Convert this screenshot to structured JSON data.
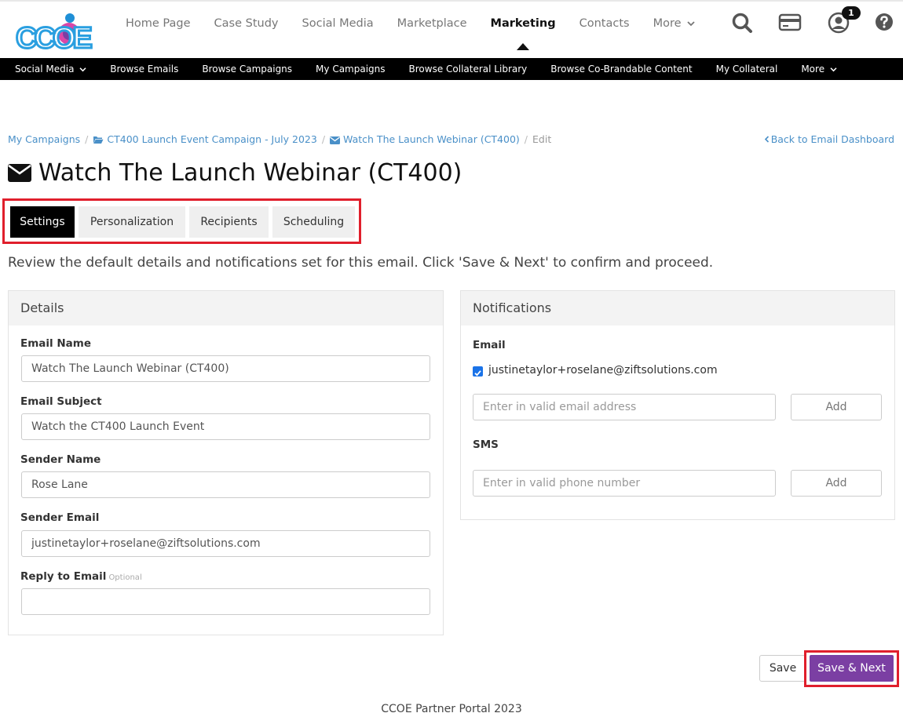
{
  "topnav": {
    "items": [
      {
        "label": "Home Page"
      },
      {
        "label": "Case Study"
      },
      {
        "label": "Social Media"
      },
      {
        "label": "Marketplace"
      },
      {
        "label": "Marketing"
      },
      {
        "label": "Contacts"
      },
      {
        "label": "More"
      }
    ],
    "notification_count": "1"
  },
  "subnav": {
    "items": [
      {
        "label": "Social Media"
      },
      {
        "label": "Browse Emails"
      },
      {
        "label": "Browse Campaigns"
      },
      {
        "label": "My Campaigns"
      },
      {
        "label": "Browse Collateral Library"
      },
      {
        "label": "Browse Co-Brandable Content"
      },
      {
        "label": "My Collateral"
      },
      {
        "label": "More"
      }
    ]
  },
  "breadcrumb": {
    "items": [
      {
        "label": "My Campaigns"
      },
      {
        "label": "CT400 Launch Event Campaign - July 2023"
      },
      {
        "label": "Watch The Launch Webinar (CT400)"
      },
      {
        "label": "Edit"
      }
    ],
    "back_label": "Back to Email Dashboard"
  },
  "page": {
    "title": "Watch The Launch Webinar (CT400)",
    "intro": "Review the default details and notifications set for this email. Click 'Save & Next' to confirm and proceed."
  },
  "tabs": [
    {
      "label": "Settings"
    },
    {
      "label": "Personalization"
    },
    {
      "label": "Recipients"
    },
    {
      "label": "Scheduling"
    }
  ],
  "details": {
    "heading": "Details",
    "email_name_label": "Email Name",
    "email_name_value": "Watch The Launch Webinar (CT400)",
    "email_subject_label": "Email Subject",
    "email_subject_value": "Watch the CT400 Launch Event",
    "sender_name_label": "Sender Name",
    "sender_name_value": "Rose Lane",
    "sender_email_label": "Sender Email",
    "sender_email_value": "justinetaylor+roselane@ziftsolutions.com",
    "reply_label": "Reply to Email",
    "reply_optional": "Optional",
    "reply_value": ""
  },
  "notifications": {
    "heading": "Notifications",
    "email_label": "Email",
    "checked_email": "justinetaylor+roselane@ziftsolutions.com",
    "email_placeholder": "Enter in valid email address",
    "add_label": "Add",
    "sms_label": "SMS",
    "sms_placeholder": "Enter in valid phone number"
  },
  "actions": {
    "save_label": "Save",
    "save_next_label": "Save & Next"
  },
  "footer": {
    "text": "CCOE Partner Portal 2023"
  },
  "colors": {
    "accent": "#7b3fa3",
    "link": "#4a90c8",
    "highlight": "#e01f2c"
  }
}
